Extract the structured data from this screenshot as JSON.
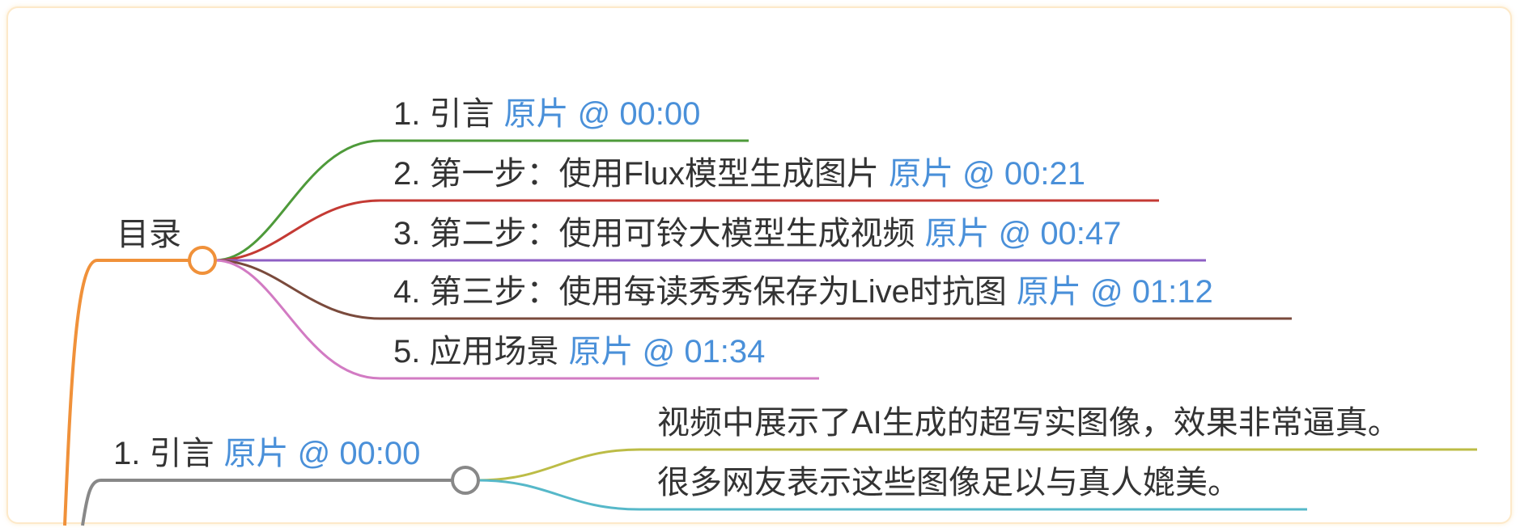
{
  "mindmap": {
    "toc": {
      "label": "目录",
      "items": [
        {
          "text": "1. 引言",
          "link": "原片 @ 00:00",
          "color": "#4e9a3a"
        },
        {
          "text": "2. 第一步：使用Flux模型生成图片",
          "link": "原片 @ 00:21",
          "color": "#c43a34"
        },
        {
          "text": "3. 第二步：使用可铃大模型生成视频",
          "link": "原片 @ 00:47",
          "color": "#8e5fc4"
        },
        {
          "text": "4. 第三步：使用每读秀秀保存为Live时抗图",
          "link": "原片 @ 01:12",
          "color": "#7a4a3c"
        },
        {
          "text": "5. 应用场景",
          "link": "原片 @ 01:34",
          "color": "#d27bc3"
        }
      ]
    },
    "intro": {
      "text": "1. 引言",
      "link": "原片 @ 00:00",
      "children": [
        {
          "text": "视频中展示了AI生成的超写实图像，效果非常逼真。",
          "color": "#bcbc46"
        },
        {
          "text": "很多网友表示这些图像足以与真人媲美。",
          "color": "#56b8c9"
        }
      ]
    },
    "colors": {
      "root_branch": "#f0913a",
      "intro_branch": "#888888"
    }
  }
}
